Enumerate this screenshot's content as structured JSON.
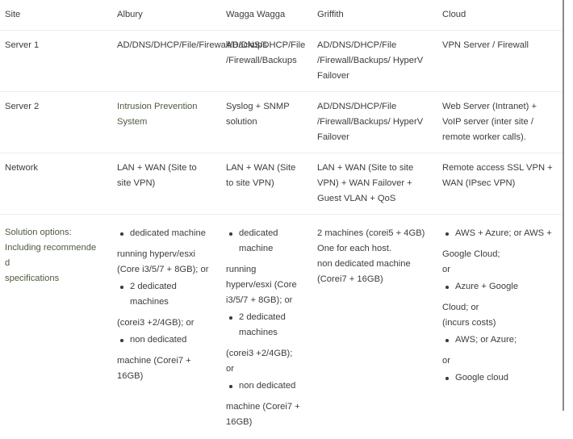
{
  "table": {
    "headers": [
      {
        "key": "site",
        "label": "Site"
      },
      {
        "key": "alb",
        "label": "Albury"
      },
      {
        "key": "wag",
        "label": "Wagga Wagga"
      },
      {
        "key": "gri",
        "label": "Griffith"
      },
      {
        "key": "cloud",
        "label": "Cloud"
      }
    ],
    "rows": {
      "server1": {
        "label": "Server 1",
        "albury": "AD/DNS/DHCP/File/Firewall/Backups",
        "wagga": "AD/DNS/DHCP/File /Firewall/Backups",
        "griffith": "AD/DNS/DHCP/File /Firewall/Backups/ HyperV Failover",
        "cloud": "VPN Server / Firewall"
      },
      "server2": {
        "label": "Server 2",
        "albury": "Intrusion Prevention System",
        "wagga": "Syslog + SNMP solution",
        "griffith": "AD/DNS/DHCP/File /Firewall/Backups/ HyperV Failover",
        "cloud": "Web Server (Intranet) + VoIP server (inter site / remote worker calls)."
      },
      "network": {
        "label": "Network",
        "albury": "LAN + WAN (Site to site VPN)",
        "wagga": "LAN + WAN (Site to site VPN)",
        "griffith": "LAN + WAN (Site to site VPN) + WAN Failover + Guest VLAN + QoS",
        "cloud": "Remote access SSL VPN + WAN (IPsec VPN)"
      },
      "solutions": {
        "label_line1": "Solution options:",
        "label_line2": "Including recommende d",
        "label_line3": "specifications",
        "albury_items": [
          {
            "bullet": "dedicated machine",
            "sub": "running hyperv/esxi (Core i3/5/7 + 8GB); or"
          },
          {
            "bullet": "2 dedicated machines",
            "sub": "(corei3 +2/4GB); or"
          },
          {
            "bullet": "non dedicated",
            "sub": "machine (Corei7 + 16GB)"
          }
        ],
        "wagga_items": [
          {
            "bullet": "dedicated machine",
            "sub": "running hyperv/esxi (Core i3/5/7 + 8GB); or"
          },
          {
            "bullet": "2 dedicated machines",
            "sub": "(corei3 +2/4GB); or"
          },
          {
            "bullet": "non dedicated",
            "sub": "machine (Corei7 + 16GB)"
          }
        ],
        "griffith_lines": [
          "2 machines (corei5 + 4GB)",
          "One for each host.",
          "non dedicated machine",
          "(Corei7 + 16GB)"
        ],
        "cloud_items": [
          {
            "bullet": "AWS + Azure; or AWS +",
            "sub": "Google Cloud;\nor"
          },
          {
            "bullet": "Azure + Google",
            "sub": "Cloud; or\n(incurs costs)"
          },
          {
            "bullet": "AWS; or Azure;",
            "sub": "or"
          },
          {
            "bullet": "Google cloud",
            "sub": ""
          }
        ]
      }
    }
  },
  "colors": {
    "text": "#3c3c3c",
    "tinted_text": "#4c5a3e",
    "row_divider": "#ececec",
    "right_rule": "#8a8a8a",
    "background": "#ffffff"
  }
}
